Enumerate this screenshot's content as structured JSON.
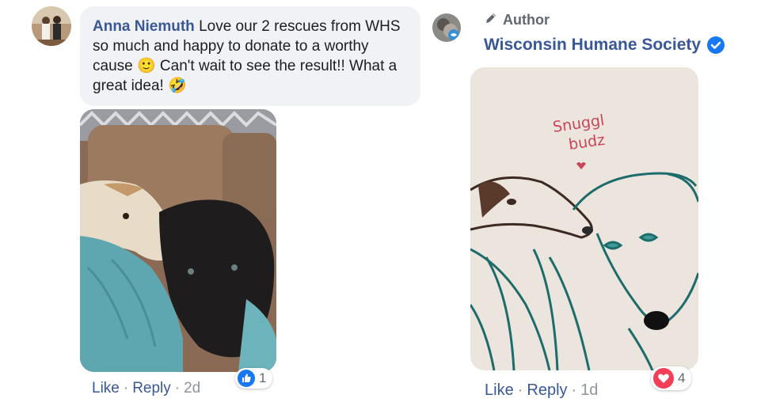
{
  "comments": [
    {
      "author": "Anna Niemuth",
      "text": "Love our 2 rescues from WHS so much and happy to donate to a worthy cause 🙂 Can't wait to see the result!! What a great idea! 🤣",
      "actions": {
        "like": "Like",
        "reply": "Reply",
        "time": "2d"
      },
      "reaction": {
        "icon": "thumbs-up-icon",
        "color": "#1877f2",
        "count": "1"
      },
      "photo": "two-dogs-on-couch-photo"
    },
    {
      "badge": "Author",
      "author": "Wisconsin Humane Society",
      "drawing_text_line1": "Snuggl",
      "drawing_text_line2": "budz",
      "actions": {
        "like": "Like",
        "reply": "Reply",
        "time": "1d"
      },
      "reaction": {
        "icon": "heart-icon",
        "color": "#f33e58",
        "count": "4"
      },
      "photo": "drawing-of-two-dogs"
    }
  ],
  "colors": {
    "link": "#385898",
    "bubble": "#f0f2f5",
    "verified": "#1877f2"
  }
}
